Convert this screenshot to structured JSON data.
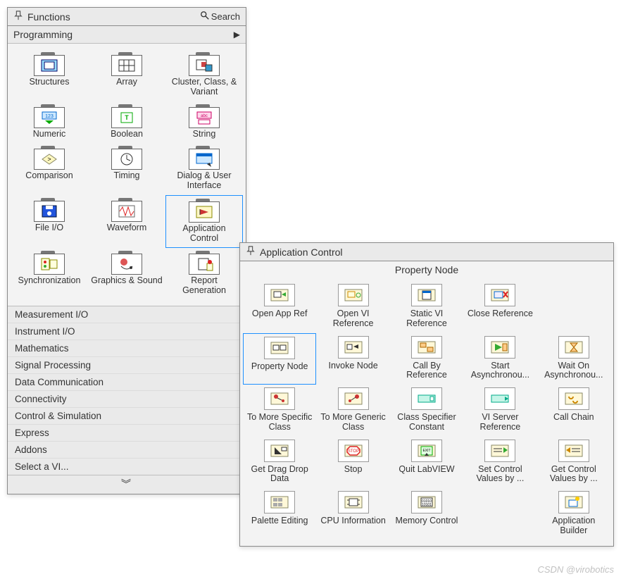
{
  "functions_panel": {
    "title": "Functions",
    "search_label": "Search",
    "subheader": "Programming",
    "items": [
      {
        "label": "Structures"
      },
      {
        "label": "Array"
      },
      {
        "label": "Cluster, Class, & Variant"
      },
      {
        "label": "Numeric"
      },
      {
        "label": "Boolean"
      },
      {
        "label": "String"
      },
      {
        "label": "Comparison"
      },
      {
        "label": "Timing"
      },
      {
        "label": "Dialog & User Interface"
      },
      {
        "label": "File I/O"
      },
      {
        "label": "Waveform"
      },
      {
        "label": "Application Control",
        "selected": true
      },
      {
        "label": "Synchronization"
      },
      {
        "label": "Graphics & Sound"
      },
      {
        "label": "Report Generation"
      }
    ],
    "categories": [
      "Measurement I/O",
      "Instrument I/O",
      "Mathematics",
      "Signal Processing",
      "Data Communication",
      "Connectivity",
      "Control & Simulation",
      "Express",
      "Addons",
      "Select a VI..."
    ],
    "expand_glyph": "︾"
  },
  "appctrl_panel": {
    "title": "Application Control",
    "subtitle": "Property Node",
    "items": [
      {
        "label": "Open App Ref"
      },
      {
        "label": "Open VI Reference"
      },
      {
        "label": "Static VI Reference"
      },
      {
        "label": "Close Reference"
      },
      {
        "label": "",
        "empty": true
      },
      {
        "label": "Property Node",
        "selected": true
      },
      {
        "label": "Invoke Node"
      },
      {
        "label": "Call By Reference"
      },
      {
        "label": "Start Asynchronou..."
      },
      {
        "label": "Wait On Asynchronou..."
      },
      {
        "label": "To More Specific Class"
      },
      {
        "label": "To More Generic Class"
      },
      {
        "label": "Class Specifier Constant"
      },
      {
        "label": "VI Server Reference"
      },
      {
        "label": "Call Chain"
      },
      {
        "label": "Get Drag Drop Data"
      },
      {
        "label": "Stop"
      },
      {
        "label": "Quit LabVIEW"
      },
      {
        "label": "Set Control Values by ..."
      },
      {
        "label": "Get Control Values by ..."
      },
      {
        "label": "Palette Editing"
      },
      {
        "label": "CPU Information"
      },
      {
        "label": "Memory Control"
      },
      {
        "label": "",
        "empty": true
      },
      {
        "label": "Application Builder"
      }
    ]
  },
  "watermark": "CSDN @virobotics"
}
